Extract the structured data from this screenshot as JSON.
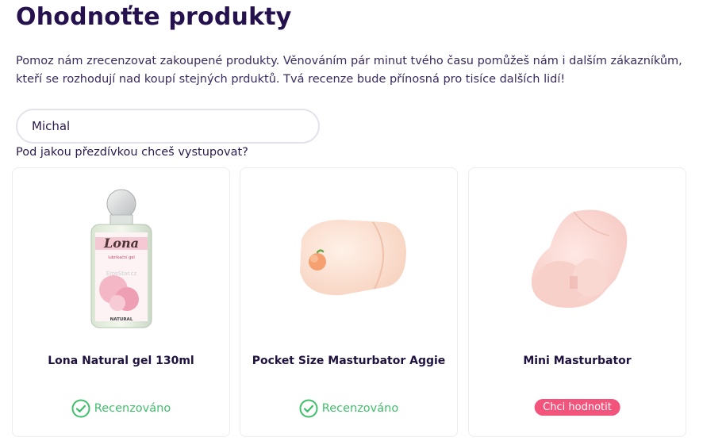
{
  "page": {
    "title": "Ohodnoťte produkty",
    "intro": "Pomoz nám zrecenzovat zakoupené produkty. Věnováním pár minut tvého času pomůžeš nám i dalším zákazníkům, kteří se rozhodují nad koupí stejných prduktů. Tvá recenze bude přínosná pro tisíce dalších lidí!"
  },
  "nickname": {
    "value": "Michal",
    "label": "Pod jakou přezdívkou chceš vystupovat?"
  },
  "products": [
    {
      "name": "Lona Natural gel 130ml",
      "status": "Recenzováno",
      "image_icon": "lubricant-bottle-icon",
      "bottle_brand": "Lona",
      "bottle_subtitle": "lubrikační gel",
      "bottle_variant": "NATURAL",
      "bottle_watermark": "ErosStar.cz"
    },
    {
      "name": "Pocket Size Masturbator Aggie",
      "status": "Recenzováno",
      "image_icon": "pocket-masturbator-icon"
    },
    {
      "name": "Mini Masturbator",
      "action": "Chci hodnotit",
      "image_icon": "mini-masturbator-icon"
    }
  ],
  "colors": {
    "title": "#24114d",
    "text": "#3a2a5f",
    "reviewed_green": "#3fbf6a",
    "rate_button": "#f2547c",
    "card_border": "#ececf0"
  }
}
